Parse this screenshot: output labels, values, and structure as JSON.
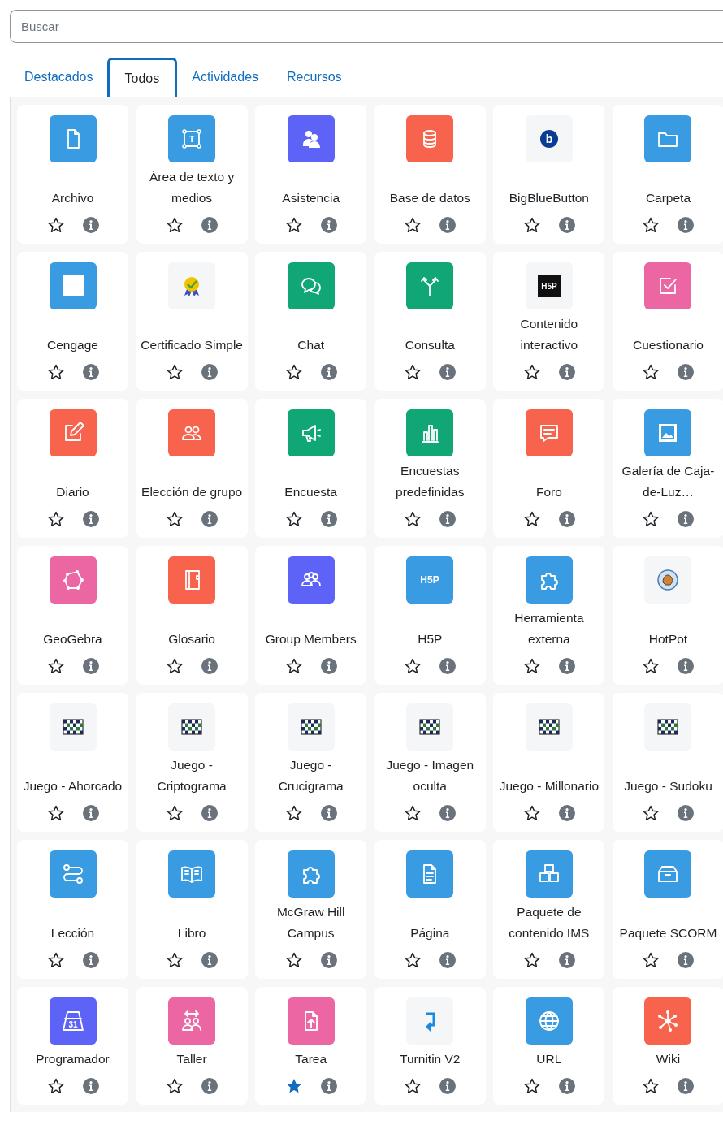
{
  "search": {
    "placeholder": "Buscar"
  },
  "tabs": [
    {
      "label": "Destacados",
      "selected": false
    },
    {
      "label": "Todos",
      "selected": true
    },
    {
      "label": "Actividades",
      "selected": false
    },
    {
      "label": "Recursos",
      "selected": false
    }
  ],
  "modules": [
    {
      "label": "Archivo",
      "color": "#399be2",
      "starred": false
    },
    {
      "label": "Área de texto y medios",
      "color": "#399be2",
      "icon_text": "T",
      "starred": false
    },
    {
      "label": "Asistencia",
      "color": "#5d63f6",
      "starred": false
    },
    {
      "label": "Base de datos",
      "color": "#f7634d",
      "starred": false
    },
    {
      "label": "BigBlueButton",
      "color": "#f5f6f8",
      "icon_text": "b",
      "starred": false
    },
    {
      "label": "Carpeta",
      "color": "#399be2",
      "starred": false
    },
    {
      "label": "Cengage",
      "color": "#399be2",
      "starred": false
    },
    {
      "label": "Certificado Simple",
      "color": "#f5f6f8",
      "starred": false
    },
    {
      "label": "Chat",
      "color": "#11a676",
      "starred": false
    },
    {
      "label": "Consulta",
      "color": "#11a676",
      "starred": false
    },
    {
      "label": "Contenido interactivo",
      "color": "#f5f6f8",
      "icon_text": "H5P",
      "starred": false
    },
    {
      "label": "Cuestionario",
      "color": "#eb66a2",
      "starred": false
    },
    {
      "label": "Diario",
      "color": "#f7634d",
      "starred": false
    },
    {
      "label": "Elección de grupo",
      "color": "#f7634d",
      "starred": false
    },
    {
      "label": "Encuesta",
      "color": "#11a676",
      "starred": false
    },
    {
      "label": "Encuestas predefinidas",
      "color": "#11a676",
      "starred": false
    },
    {
      "label": "Foro",
      "color": "#f7634d",
      "starred": false
    },
    {
      "label": "Galería de Caja-de-Luz…",
      "color": "#399be2",
      "starred": false
    },
    {
      "label": "GeoGebra",
      "color": "#eb66a2",
      "starred": false
    },
    {
      "label": "Glosario",
      "color": "#f7634d",
      "starred": false
    },
    {
      "label": "Group Members",
      "color": "#5d63f6",
      "starred": false
    },
    {
      "label": "H5P",
      "color": "#399be2",
      "icon_text": "H5P",
      "starred": false
    },
    {
      "label": "Herramienta externa",
      "color": "#399be2",
      "starred": false
    },
    {
      "label": "HotPot",
      "color": "#f5f6f8",
      "starred": false
    },
    {
      "label": "Juego - Ahorcado",
      "color": "#f5f6f8",
      "starred": false
    },
    {
      "label": "Juego - Criptograma",
      "color": "#f5f6f8",
      "starred": false
    },
    {
      "label": "Juego - Crucigrama",
      "color": "#f5f6f8",
      "starred": false
    },
    {
      "label": "Juego - Imagen oculta",
      "color": "#f5f6f8",
      "starred": false
    },
    {
      "label": "Juego - Millonario",
      "color": "#f5f6f8",
      "starred": false
    },
    {
      "label": "Juego - Sudoku",
      "color": "#f5f6f8",
      "starred": false
    },
    {
      "label": "Lección",
      "color": "#399be2",
      "starred": false
    },
    {
      "label": "Libro",
      "color": "#399be2",
      "starred": false
    },
    {
      "label": "McGraw Hill Campus",
      "color": "#399be2",
      "starred": false
    },
    {
      "label": "Página",
      "color": "#399be2",
      "starred": false
    },
    {
      "label": "Paquete de contenido IMS",
      "color": "#399be2",
      "starred": false
    },
    {
      "label": "Paquete SCORM",
      "color": "#399be2",
      "starred": false
    },
    {
      "label": "Programador",
      "color": "#5d63f6",
      "icon_text": "31",
      "starred": false
    },
    {
      "label": "Taller",
      "color": "#eb66a2",
      "starred": false
    },
    {
      "label": "Tarea",
      "color": "#eb66a2",
      "starred": true
    },
    {
      "label": "Turnitin V2",
      "color": "#f5f6f8",
      "starred": false
    },
    {
      "label": "URL",
      "color": "#399be2",
      "starred": false
    },
    {
      "label": "Wiki",
      "color": "#f7634d",
      "starred": false
    }
  ]
}
